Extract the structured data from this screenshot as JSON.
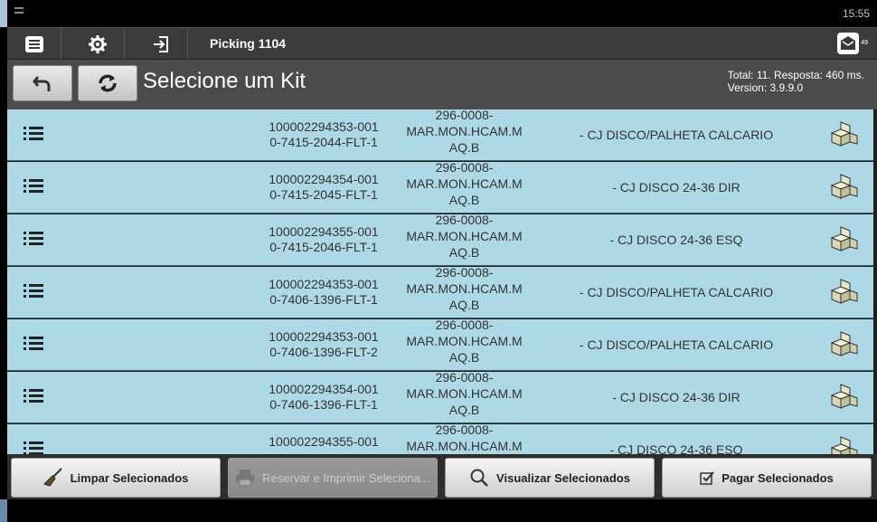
{
  "status": {
    "time": "15:55"
  },
  "toolbar": {
    "title": "Picking 1104",
    "mail_count": "49"
  },
  "header": {
    "title": "Selecione um Kit",
    "info_line1": "Total: 11. Resposta: 460 ms.",
    "info_line2": "Version: 3.9.9.0"
  },
  "rows": [
    {
      "code1": "100002294353-001",
      "code2": "0-7415-2044-FLT-1",
      "ref1": "296-0008-",
      "ref2": "MAR.MON.HCAM.M",
      "ref3": "AQ.B",
      "desc": "- CJ DISCO/PALHETA CALCARIO"
    },
    {
      "code1": "100002294354-001",
      "code2": "0-7415-2045-FLT-1",
      "ref1": "296-0008-",
      "ref2": "MAR.MON.HCAM.M",
      "ref3": "AQ.B",
      "desc": "- CJ DISCO 24-36 DIR"
    },
    {
      "code1": "100002294355-001",
      "code2": "0-7415-2046-FLT-1",
      "ref1": "296-0008-",
      "ref2": "MAR.MON.HCAM.M",
      "ref3": "AQ.B",
      "desc": "- CJ DISCO 24-36 ESQ"
    },
    {
      "code1": "100002294353-001",
      "code2": "0-7406-1396-FLT-1",
      "ref1": "296-0008-",
      "ref2": "MAR.MON.HCAM.M",
      "ref3": "AQ.B",
      "desc": "- CJ DISCO/PALHETA CALCARIO"
    },
    {
      "code1": "100002294353-001",
      "code2": "0-7406-1396-FLT-2",
      "ref1": "296-0008-",
      "ref2": "MAR.MON.HCAM.M",
      "ref3": "AQ.B",
      "desc": "- CJ DISCO/PALHETA CALCARIO"
    },
    {
      "code1": "100002294354-001",
      "code2": "0-7406-1396-FLT-1",
      "ref1": "296-0008-",
      "ref2": "MAR.MON.HCAM.M",
      "ref3": "AQ.B",
      "desc": "- CJ DISCO 24-36 DIR"
    },
    {
      "code1": "100002294355-001",
      "code2": "",
      "ref1": "296-0008-",
      "ref2": "MAR.MON.HCAM.M",
      "ref3": "",
      "desc": "- CJ DISCO 24-36 ESQ"
    }
  ],
  "footer": {
    "clear_label": "Limpar Selecionados",
    "reserve_label": "Reservar e Imprimir Seleciona...",
    "view_label": "Visualizar Selecionados",
    "pay_label": "Pagar Selecionados"
  },
  "icons": {
    "menu": "menu-icon",
    "settings": "gear-icon",
    "login": "login-icon",
    "mail": "mail-icon",
    "undo": "undo-icon",
    "refresh": "refresh-icon",
    "list": "list-icon",
    "package": "boxes-icon",
    "broom": "broom-icon",
    "printer": "printer-icon",
    "search": "search-icon",
    "check": "checkbox-icon"
  }
}
